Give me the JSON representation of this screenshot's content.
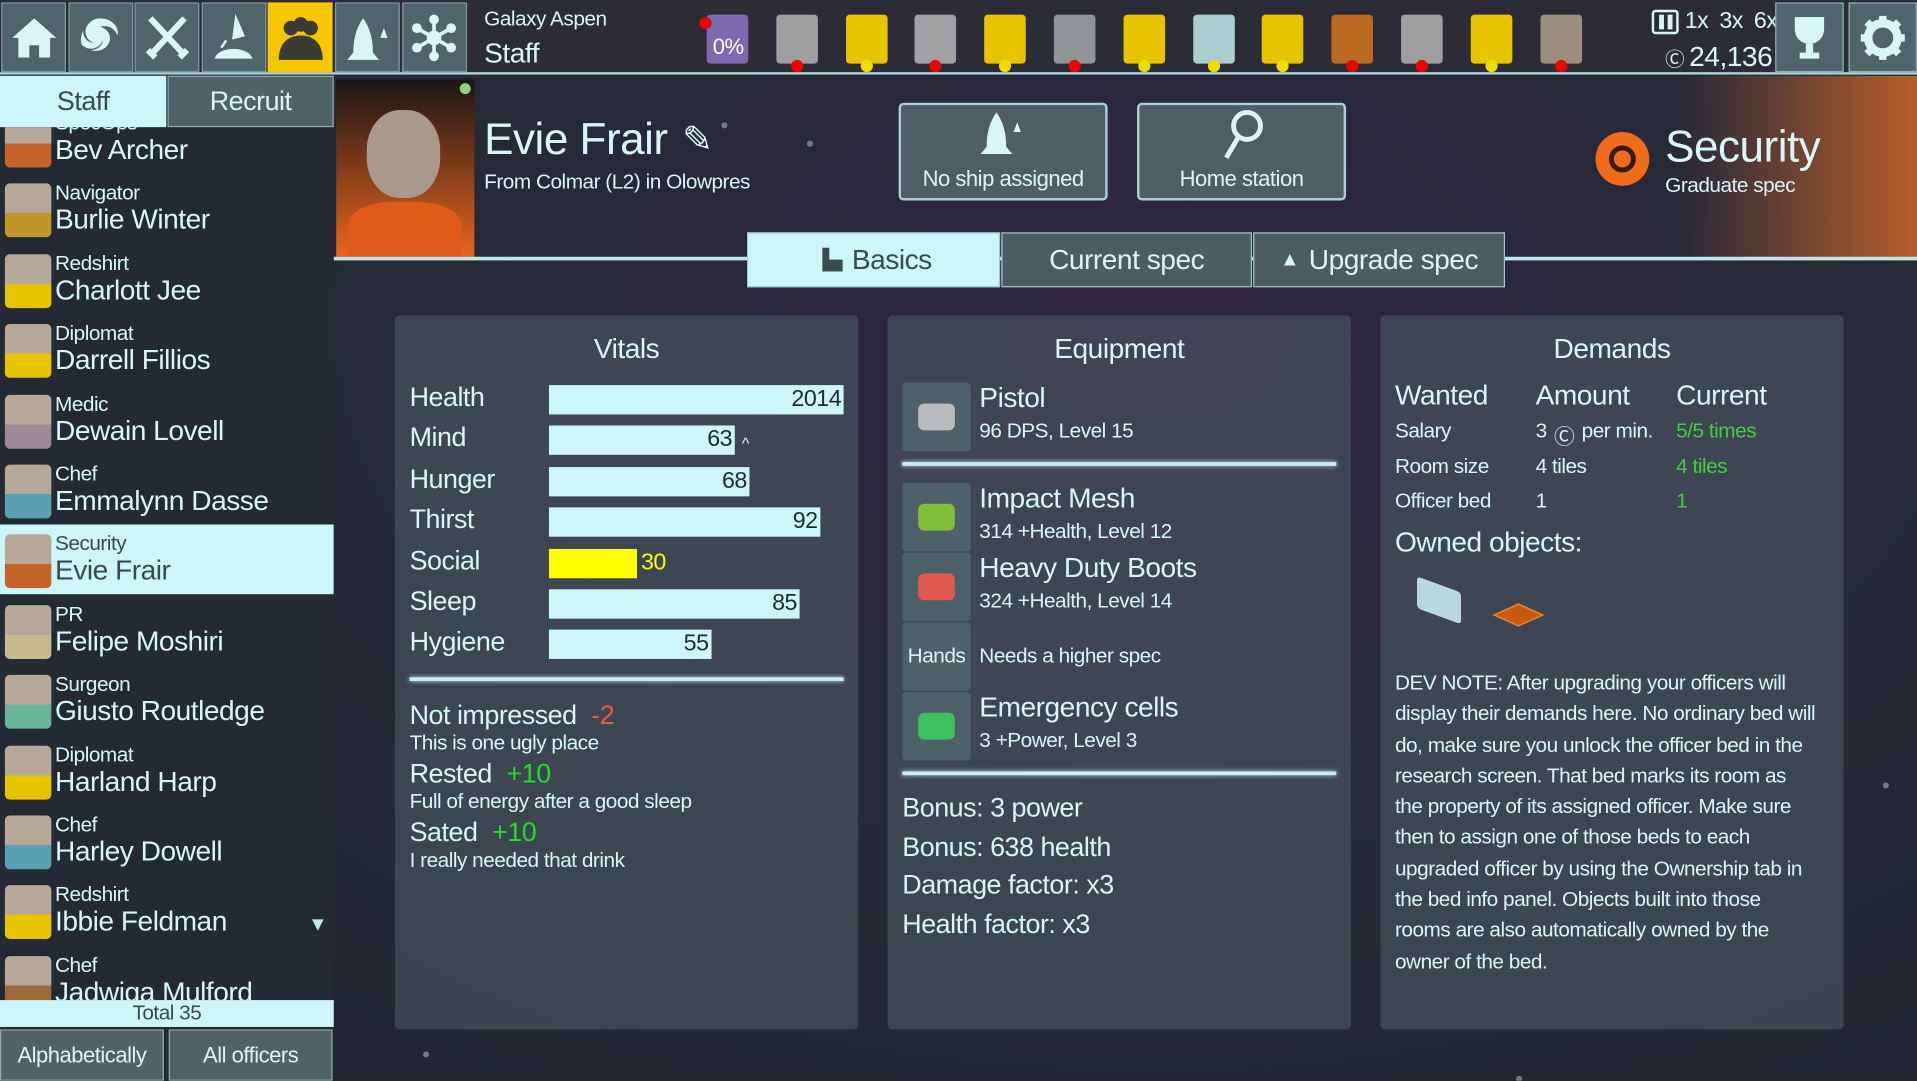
{
  "topbar": {
    "nav": [
      {
        "icon": "home-icon"
      },
      {
        "icon": "galaxy-icon"
      },
      {
        "icon": "crossed-swords-icon"
      },
      {
        "icon": "ship-launch-icon"
      },
      {
        "icon": "staff-icon",
        "active": true
      },
      {
        "icon": "ship-icon"
      },
      {
        "icon": "network-icon"
      }
    ],
    "location": "Galaxy Aspen",
    "screen": "Staff",
    "alerts": [
      {
        "icon": "creature-icon",
        "label": "0%",
        "dot": "#ee0000",
        "color": "#8e7bd0"
      },
      {
        "icon": "machine-icon",
        "dot": "#ee0000",
        "color": "#b9bcbc"
      },
      {
        "icon": "officer-portrait-icon",
        "dot": "#eedd00",
        "color": "#e8c400"
      },
      {
        "icon": "console-icon",
        "dot": "#ee0000",
        "color": "#c0c0c0"
      },
      {
        "icon": "officer-portrait-icon",
        "dot": "#eedd00",
        "color": "#e8c400"
      },
      {
        "icon": "bed-icon",
        "dot": "#ee0000",
        "color": "#a9b0b0"
      },
      {
        "icon": "officer-portrait-icon",
        "dot": "#eedd00",
        "color": "#e8c400"
      },
      {
        "icon": "medkit-icon",
        "dot": "#eedd00",
        "color": "#cdf6f8"
      },
      {
        "icon": "officer-portrait-icon",
        "dot": "#eedd00",
        "color": "#e8c400"
      },
      {
        "icon": "orb-icon",
        "dot": "#ee0000",
        "color": "#e07a20"
      },
      {
        "icon": "machine-icon",
        "dot": "#ee0000",
        "color": "#b9bcbc"
      },
      {
        "icon": "officer-portrait-icon",
        "dot": "#eedd00",
        "color": "#e8c400"
      },
      {
        "icon": "workbench-icon",
        "dot": "#ee0000",
        "color": "#b9a890"
      }
    ],
    "speeds": [
      "1x",
      "3x",
      "6x"
    ],
    "credits": "24,136"
  },
  "sidebar": {
    "tabs": [
      "Staff",
      "Recruit"
    ],
    "staff": [
      {
        "role": "SpecOps",
        "name": "Bev Archer",
        "color": "#c4632a"
      },
      {
        "role": "Navigator",
        "name": "Burlie Winter",
        "color": "#c0962a"
      },
      {
        "role": "Redshirt",
        "name": "Charlott Jee",
        "color": "#e8c400"
      },
      {
        "role": "Diplomat",
        "name": "Darrell Fillios",
        "color": "#e8c400"
      },
      {
        "role": "Medic",
        "name": "Dewain Lovell",
        "color": "#9d8a96"
      },
      {
        "role": "Chef",
        "name": "Emmalynn Dasse",
        "color": "#5aa0b4"
      },
      {
        "role": "Security",
        "name": "Evie Frair",
        "color": "#c4632a",
        "selected": true
      },
      {
        "role": "PR",
        "name": "Felipe Moshiri",
        "color": "#c8b890"
      },
      {
        "role": "Surgeon",
        "name": "Giusto Routledge",
        "color": "#6ab49a"
      },
      {
        "role": "Diplomat",
        "name": "Harland Harp",
        "color": "#e8c400"
      },
      {
        "role": "Chef",
        "name": "Harley Dowell",
        "color": "#5aa0b4"
      },
      {
        "role": "Redshirt",
        "name": "Ibbie Feldman",
        "color": "#e8c400"
      },
      {
        "role": "Chef",
        "name": "Jadwiga Mulford",
        "color": "#9a6a3a"
      }
    ],
    "total": "Total 35",
    "sort": "Alphabetically",
    "filter": "All officers"
  },
  "officer": {
    "name": "Evie Frair",
    "origin": "From Colmar (L2) in Olowpres",
    "ship_button": "No ship assigned",
    "home_button": "Home station",
    "spec": "Security",
    "spec_level": "Graduate spec",
    "accent": "#f26a1b"
  },
  "tabs": [
    {
      "label": "Basics",
      "active": true
    },
    {
      "label": "Current spec"
    },
    {
      "label": "Upgrade spec"
    }
  ],
  "vitals": {
    "title": "Vitals",
    "rows": [
      {
        "label": "Health",
        "value": "2014",
        "fill": 100
      },
      {
        "label": "Mind",
        "value": "63",
        "fill": 63,
        "trend": "^"
      },
      {
        "label": "Hunger",
        "value": "68",
        "fill": 68
      },
      {
        "label": "Thirst",
        "value": "92",
        "fill": 92
      },
      {
        "label": "Social",
        "value": "30",
        "fill": 30,
        "warning": true
      },
      {
        "label": "Sleep",
        "value": "85",
        "fill": 85
      },
      {
        "label": "Hygiene",
        "value": "55",
        "fill": 55
      }
    ],
    "moods": [
      {
        "name": "Not impressed",
        "delta": "-2",
        "desc": "This is one ugly place",
        "color": "#ef5a3a"
      },
      {
        "name": "Rested",
        "delta": "+10",
        "desc": "Full of energy after a good sleep",
        "color": "#22dd22"
      },
      {
        "name": "Sated",
        "delta": "+10",
        "desc": "I really needed that drink",
        "color": "#22dd22"
      }
    ]
  },
  "equipment": {
    "title": "Equipment",
    "items": [
      {
        "icon": "pistol-icon",
        "name": "Pistol",
        "desc": "96 DPS, Level 15"
      },
      {
        "icon": "armor-icon",
        "name": "Impact Mesh",
        "desc": "314 +Health, Level 12"
      },
      {
        "icon": "boots-icon",
        "name": "Heavy Duty Boots",
        "desc": "324 +Health, Level 14"
      },
      {
        "slot": "Hands",
        "desc": "Needs a higher spec"
      },
      {
        "icon": "battery-icon",
        "name": "Emergency cells",
        "desc": "3 +Power, Level 3"
      }
    ],
    "bonuses": [
      "Bonus: 3 power",
      "Bonus: 638 health",
      "Damage factor: x3",
      "Health factor: x3"
    ]
  },
  "demands": {
    "title": "Demands",
    "headers": [
      "Wanted",
      "Amount",
      "Current"
    ],
    "rows": [
      {
        "wanted": "Salary",
        "amount": "3",
        "unit": "per min.",
        "current": "5/5 times"
      },
      {
        "wanted": "Room size",
        "amount": "4 tiles",
        "current": "4 tiles"
      },
      {
        "wanted": "Officer bed",
        "amount": "1",
        "current": "1"
      }
    ],
    "owned_label": "Owned objects:",
    "owned": [
      "bed-icon",
      "rug-icon"
    ],
    "note": "DEV NOTE: After upgrading your officers will display their demands here. No ordinary bed will do, make sure you unlock the officer bed in the research screen. That bed marks its room as the property of its assigned officer. Make sure then to assign one of those beds to each upgraded officer by using the Ownership tab in the bed info panel. Objects built into those rooms are also automatically owned by the owner of the bed.",
    "ok_color": "#44cc44"
  }
}
